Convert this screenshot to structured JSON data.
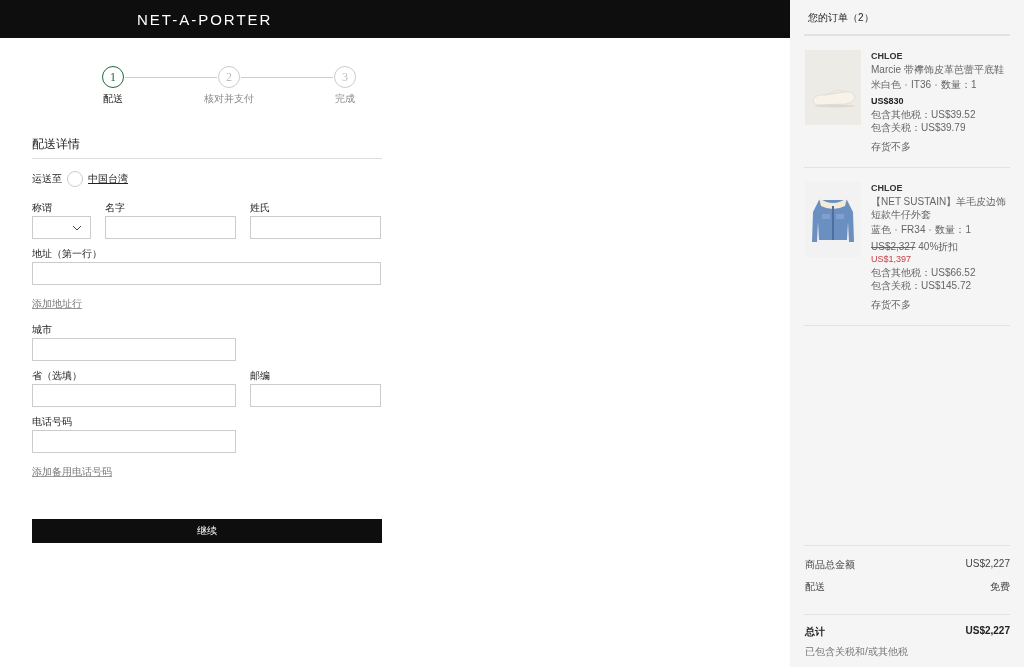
{
  "header": {
    "logo": "NET-A-PORTER"
  },
  "steps": [
    {
      "number": "1",
      "label": "配送",
      "selected": true
    },
    {
      "number": "2",
      "label": "核对并支付",
      "selected": false
    },
    {
      "number": "3",
      "label": "完成",
      "selected": false
    }
  ],
  "form": {
    "title": "配送详情",
    "ship_to": {
      "label": "运送至",
      "country": "中国台湾"
    },
    "fields": [
      {
        "kind": "select",
        "label": "称谓"
      },
      {
        "kind": "short_field",
        "label": "名字"
      },
      {
        "kind": "short_field",
        "label": "姓氏"
      },
      {
        "kind": "full_field",
        "label": "地址（第一行）"
      },
      {
        "kind": "link",
        "label": "添加地址行"
      },
      {
        "kind": "long_field",
        "label": "城市"
      },
      {
        "kind": "long_field",
        "label": "省（选填）"
      },
      {
        "kind": "short_field",
        "label": "邮编"
      },
      {
        "kind": "long_field",
        "label": "电话号码"
      },
      {
        "kind": "link",
        "label": "添加备用电话号码"
      }
    ],
    "submit": "继续"
  },
  "order": {
    "title": "您的订单（2）",
    "items": [
      {
        "brand": "CHLOE",
        "name": "Marcie 带襻饰皮革芭蕾平底鞋",
        "attributes": [
          "米白色",
          "IT36",
          "数量：1"
        ],
        "price": "US$830",
        "sale": false,
        "taxes": [
          "包含其他税：US$39.52",
          "包含关税：US$39.79"
        ],
        "stock": "存货不多",
        "kind": "shoe"
      },
      {
        "brand": "CHLOE",
        "name": "【NET SUSTAIN】羊毛皮边饰短款牛仔外套",
        "attributes": [
          "蓝色",
          "FR34",
          "数量：1"
        ],
        "original_price": "US$2,327",
        "discount": "40%折扣",
        "price": "US$1,397",
        "sale": true,
        "taxes": [
          "包含其他税：US$66.52",
          "包含关税：US$145.72"
        ],
        "stock": "存货不多",
        "kind": "jacket"
      }
    ],
    "summary": [
      {
        "label": "商品总金额",
        "value": "US$2,227"
      },
      {
        "label": "配送",
        "value": "免费"
      }
    ],
    "total": {
      "label": "总计",
      "value": "US$2,227",
      "note": "已包含关税和/或其他税"
    }
  }
}
